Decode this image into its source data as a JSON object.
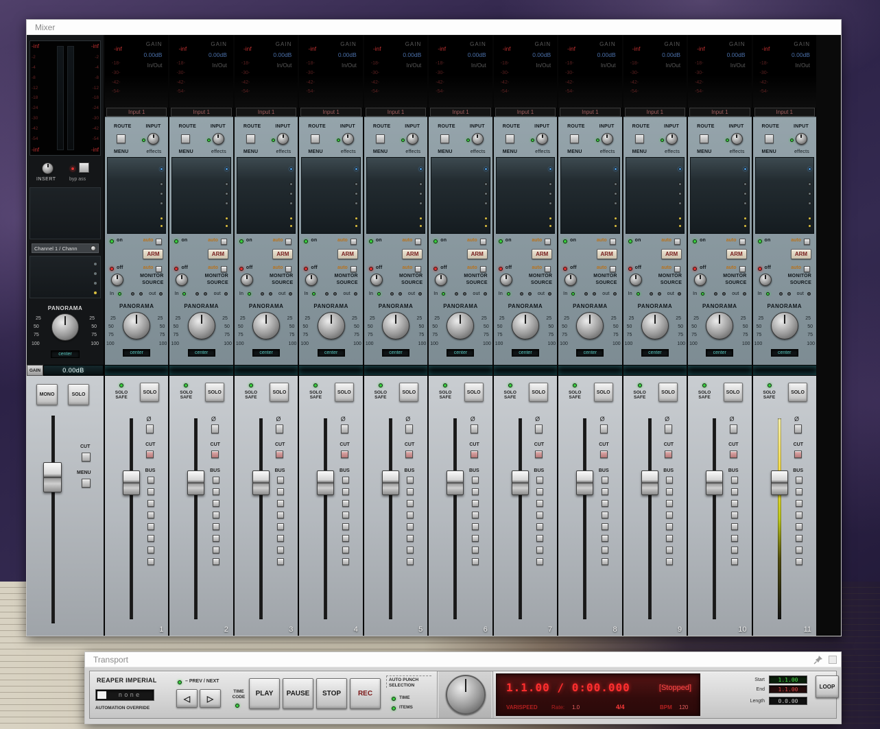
{
  "mixer": {
    "title": "Mixer",
    "strip": {
      "peak": "-inf",
      "gain_label": "GAIN",
      "gain_value": "0.00dB",
      "io_label": "In/Out",
      "meter_scale": [
        "-18-",
        "-30-",
        "-42-",
        "-54-"
      ],
      "route_label": "ROUTE",
      "input_label": "INPUT",
      "menu_label": "MENU",
      "effects_label": "effects",
      "on_label": "on",
      "off_label": "off",
      "auto_label": "auto",
      "arm_label": "ARM",
      "monitor_label": "MONITOR",
      "source_label": "SOURCE",
      "in_label": "In",
      "out_label": "out",
      "panorama_label": "PANORAMA",
      "pan_scale": [
        "25",
        "50",
        "75",
        "100"
      ],
      "pan_value": "center",
      "solo_safe_label": "SOLO SAFE",
      "solo_label": "SOLO",
      "phase_label": "Ø",
      "cut_label": "CUT",
      "bus_label": "BUS"
    },
    "master": {
      "peak": "-inf",
      "scale": [
        "-2",
        "-4",
        "-8",
        "-12",
        "-18",
        "-24",
        "-30",
        "-42",
        "-54"
      ],
      "insert_label": "INSERT",
      "bypass_label": "byp ass",
      "channel_name": "Channel 1 / Chann",
      "panorama_label": "PANORAMA",
      "pan_scale": [
        "25",
        "50",
        "75",
        "100"
      ],
      "pan_value": "center",
      "gain_label": "GAIN",
      "gain_value": "0.00dB",
      "mono_label": "MONO",
      "solo_label": "SOLO",
      "cut_label": "CUT",
      "menu_label": "MENU"
    },
    "channels": [
      {
        "number": "1",
        "input": "Input 1"
      },
      {
        "number": "2",
        "input": "Input 1"
      },
      {
        "number": "3",
        "input": "Input 1"
      },
      {
        "number": "4",
        "input": "Input 1"
      },
      {
        "number": "5",
        "input": "Input 1"
      },
      {
        "number": "6",
        "input": "Input 1"
      },
      {
        "number": "7",
        "input": "Input 1"
      },
      {
        "number": "8",
        "input": "Input 1"
      },
      {
        "number": "9",
        "input": "Input 1"
      },
      {
        "number": "10",
        "input": "Input 1"
      },
      {
        "number": "11",
        "input": "Input 1",
        "meter_active": true
      }
    ]
  },
  "transport": {
    "title": "Transport",
    "theme_label": "REAPER IMPERIAL",
    "automation_value": "none",
    "automation_label": "AUTOMATION OVERRIDE",
    "prev_next_label": "– PREV / NEXT",
    "prev_glyph": "◁",
    "next_glyph": "▷",
    "timecode_label": "TIME CODE",
    "play_label": "PLAY",
    "pause_label": "PAUSE",
    "stop_label": "STOP",
    "rec_label": "REC",
    "auto_punch_label": "AUTO PUNCH SELECTION",
    "time_label": "TIME",
    "items_label": "ITEMS",
    "position_value": "1.1.00 / 0:00.000",
    "status_value": "[Stopped]",
    "varispeed_label": "VARISPEED",
    "rate_label": "Rate:",
    "rate_value": "1.0",
    "timesig_value": "4/4",
    "bpm_label": "BPM",
    "bpm_value": "120",
    "start_label": "Start",
    "start_value": "1.1.00",
    "end_label": "End",
    "end_value": "1.1.00",
    "length_label": "Length",
    "length_value": "0.0.00",
    "loop_label": "LOOP"
  }
}
